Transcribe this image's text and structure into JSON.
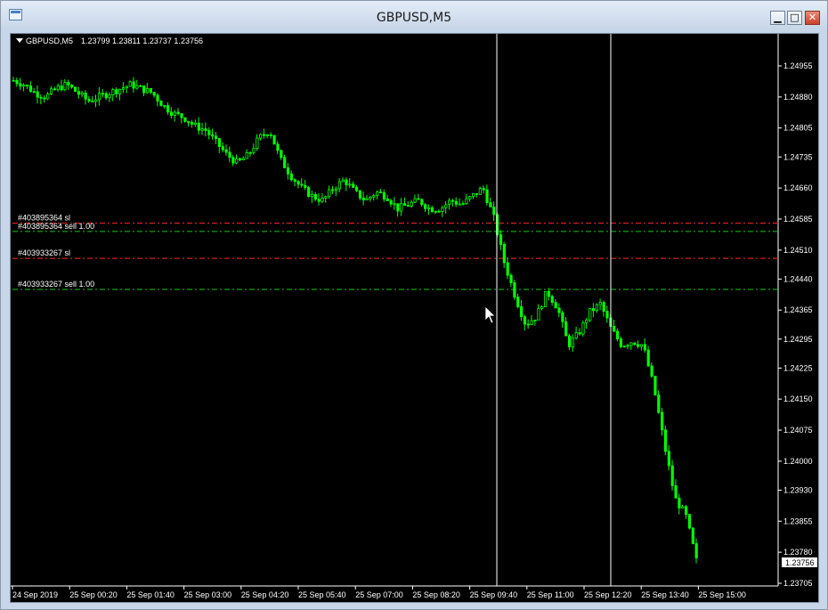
{
  "window": {
    "title": "GBPUSD,M5",
    "buttons": {
      "minimize": "▁",
      "maximize": "□",
      "close": "✕"
    }
  },
  "chart_header": {
    "symbol_tf": "GBPUSD,M5",
    "ohlc": "1.23799 1.23811 1.23737 1.23756"
  },
  "colors": {
    "background": "#000000",
    "candle_bull": "#00ff00",
    "candle_bear": "#00ff00",
    "sl_line": "#ff0000",
    "order_line": "#00cc00",
    "text": "#ffffff",
    "vline": "#ffffff"
  },
  "chart_data": {
    "type": "candlestick",
    "symbol": "GBPUSD",
    "timeframe": "M5",
    "ylim": [
      1.23705,
      1.25005
    ],
    "price_ticks": [
      "1.24955",
      "1.24880",
      "1.24805",
      "1.24735",
      "1.24660",
      "1.24585",
      "1.24510",
      "1.24440",
      "1.24365",
      "1.24295",
      "1.24225",
      "1.24150",
      "1.24075",
      "1.24000",
      "1.23930",
      "1.23855",
      "1.23780",
      "1.23705"
    ],
    "current_price": "1.23756",
    "time_ticks": [
      "24 Sep 2019",
      "25 Sep 00:20",
      "25 Sep 01:40",
      "25 Sep 03:00",
      "25 Sep 04:20",
      "25 Sep 05:40",
      "25 Sep 07:00",
      "25 Sep 08:20",
      "25 Sep 09:40",
      "25 Sep 11:00",
      "25 Sep 12:20",
      "25 Sep 13:40",
      "25 Sep 15:00"
    ],
    "close_path": [
      1.2492,
      1.2491,
      1.2489,
      1.2488,
      1.249,
      1.2491,
      1.2489,
      1.2487,
      1.2488,
      1.2489,
      1.249,
      1.2491,
      1.249,
      1.2489,
      1.2486,
      1.2484,
      1.2483,
      1.2481,
      1.248,
      1.2477,
      1.2474,
      1.2472,
      1.2474,
      1.2478,
      1.248,
      1.2473,
      1.2469,
      1.2466,
      1.2464,
      1.2463,
      1.2466,
      1.2468,
      1.2465,
      1.2463,
      1.2465,
      1.2464,
      1.2461,
      1.2462,
      1.2463,
      1.2461,
      1.2461,
      1.2463,
      1.2462,
      1.2464,
      1.2466,
      1.2459,
      1.2448,
      1.244,
      1.2433,
      1.2435,
      1.2441,
      1.2437,
      1.2428,
      1.2431,
      1.2436,
      1.2438,
      1.2432,
      1.2428,
      1.2429,
      1.2428,
      1.2418,
      1.2404,
      1.2391,
      1.2387,
      1.2376
    ],
    "orders": [
      {
        "label": "#403895364 sl",
        "price": 1.24575,
        "kind": "sl"
      },
      {
        "label": "#403895364 sell 1.00",
        "price": 1.24555,
        "kind": "order"
      },
      {
        "label": "#403933267 sl",
        "price": 1.2449,
        "kind": "sl"
      },
      {
        "label": "#403933267 sell 1.00",
        "price": 1.24415,
        "kind": "order"
      }
    ]
  }
}
